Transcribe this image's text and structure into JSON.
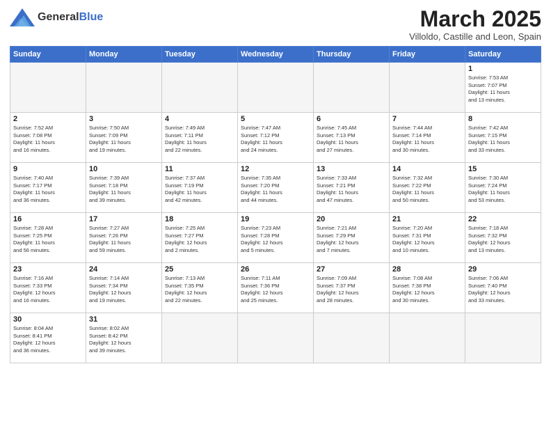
{
  "header": {
    "logo_general": "General",
    "logo_blue": "Blue",
    "month_title": "March 2025",
    "subtitle": "Villoldo, Castille and Leon, Spain"
  },
  "weekdays": [
    "Sunday",
    "Monday",
    "Tuesday",
    "Wednesday",
    "Thursday",
    "Friday",
    "Saturday"
  ],
  "weeks": [
    [
      {
        "day": "",
        "info": ""
      },
      {
        "day": "",
        "info": ""
      },
      {
        "day": "",
        "info": ""
      },
      {
        "day": "",
        "info": ""
      },
      {
        "day": "",
        "info": ""
      },
      {
        "day": "",
        "info": ""
      },
      {
        "day": "1",
        "info": "Sunrise: 7:53 AM\nSunset: 7:07 PM\nDaylight: 11 hours\nand 13 minutes."
      }
    ],
    [
      {
        "day": "2",
        "info": "Sunrise: 7:52 AM\nSunset: 7:08 PM\nDaylight: 11 hours\nand 16 minutes."
      },
      {
        "day": "3",
        "info": "Sunrise: 7:50 AM\nSunset: 7:09 PM\nDaylight: 11 hours\nand 19 minutes."
      },
      {
        "day": "4",
        "info": "Sunrise: 7:49 AM\nSunset: 7:11 PM\nDaylight: 11 hours\nand 22 minutes."
      },
      {
        "day": "5",
        "info": "Sunrise: 7:47 AM\nSunset: 7:12 PM\nDaylight: 11 hours\nand 24 minutes."
      },
      {
        "day": "6",
        "info": "Sunrise: 7:45 AM\nSunset: 7:13 PM\nDaylight: 11 hours\nand 27 minutes."
      },
      {
        "day": "7",
        "info": "Sunrise: 7:44 AM\nSunset: 7:14 PM\nDaylight: 11 hours\nand 30 minutes."
      },
      {
        "day": "8",
        "info": "Sunrise: 7:42 AM\nSunset: 7:15 PM\nDaylight: 11 hours\nand 33 minutes."
      }
    ],
    [
      {
        "day": "9",
        "info": "Sunrise: 7:40 AM\nSunset: 7:17 PM\nDaylight: 11 hours\nand 36 minutes."
      },
      {
        "day": "10",
        "info": "Sunrise: 7:39 AM\nSunset: 7:18 PM\nDaylight: 11 hours\nand 39 minutes."
      },
      {
        "day": "11",
        "info": "Sunrise: 7:37 AM\nSunset: 7:19 PM\nDaylight: 11 hours\nand 42 minutes."
      },
      {
        "day": "12",
        "info": "Sunrise: 7:35 AM\nSunset: 7:20 PM\nDaylight: 11 hours\nand 44 minutes."
      },
      {
        "day": "13",
        "info": "Sunrise: 7:33 AM\nSunset: 7:21 PM\nDaylight: 11 hours\nand 47 minutes."
      },
      {
        "day": "14",
        "info": "Sunrise: 7:32 AM\nSunset: 7:22 PM\nDaylight: 11 hours\nand 50 minutes."
      },
      {
        "day": "15",
        "info": "Sunrise: 7:30 AM\nSunset: 7:24 PM\nDaylight: 11 hours\nand 53 minutes."
      }
    ],
    [
      {
        "day": "16",
        "info": "Sunrise: 7:28 AM\nSunset: 7:25 PM\nDaylight: 11 hours\nand 56 minutes."
      },
      {
        "day": "17",
        "info": "Sunrise: 7:27 AM\nSunset: 7:26 PM\nDaylight: 11 hours\nand 59 minutes."
      },
      {
        "day": "18",
        "info": "Sunrise: 7:25 AM\nSunset: 7:27 PM\nDaylight: 12 hours\nand 2 minutes."
      },
      {
        "day": "19",
        "info": "Sunrise: 7:23 AM\nSunset: 7:28 PM\nDaylight: 12 hours\nand 5 minutes."
      },
      {
        "day": "20",
        "info": "Sunrise: 7:21 AM\nSunset: 7:29 PM\nDaylight: 12 hours\nand 7 minutes."
      },
      {
        "day": "21",
        "info": "Sunrise: 7:20 AM\nSunset: 7:31 PM\nDaylight: 12 hours\nand 10 minutes."
      },
      {
        "day": "22",
        "info": "Sunrise: 7:18 AM\nSunset: 7:32 PM\nDaylight: 12 hours\nand 13 minutes."
      }
    ],
    [
      {
        "day": "23",
        "info": "Sunrise: 7:16 AM\nSunset: 7:33 PM\nDaylight: 12 hours\nand 16 minutes."
      },
      {
        "day": "24",
        "info": "Sunrise: 7:14 AM\nSunset: 7:34 PM\nDaylight: 12 hours\nand 19 minutes."
      },
      {
        "day": "25",
        "info": "Sunrise: 7:13 AM\nSunset: 7:35 PM\nDaylight: 12 hours\nand 22 minutes."
      },
      {
        "day": "26",
        "info": "Sunrise: 7:11 AM\nSunset: 7:36 PM\nDaylight: 12 hours\nand 25 minutes."
      },
      {
        "day": "27",
        "info": "Sunrise: 7:09 AM\nSunset: 7:37 PM\nDaylight: 12 hours\nand 28 minutes."
      },
      {
        "day": "28",
        "info": "Sunrise: 7:08 AM\nSunset: 7:38 PM\nDaylight: 12 hours\nand 30 minutes."
      },
      {
        "day": "29",
        "info": "Sunrise: 7:06 AM\nSunset: 7:40 PM\nDaylight: 12 hours\nand 33 minutes."
      }
    ],
    [
      {
        "day": "30",
        "info": "Sunrise: 8:04 AM\nSunset: 8:41 PM\nDaylight: 12 hours\nand 36 minutes."
      },
      {
        "day": "31",
        "info": "Sunrise: 8:02 AM\nSunset: 8:42 PM\nDaylight: 12 hours\nand 39 minutes."
      },
      {
        "day": "",
        "info": ""
      },
      {
        "day": "",
        "info": ""
      },
      {
        "day": "",
        "info": ""
      },
      {
        "day": "",
        "info": ""
      },
      {
        "day": "",
        "info": ""
      }
    ]
  ]
}
